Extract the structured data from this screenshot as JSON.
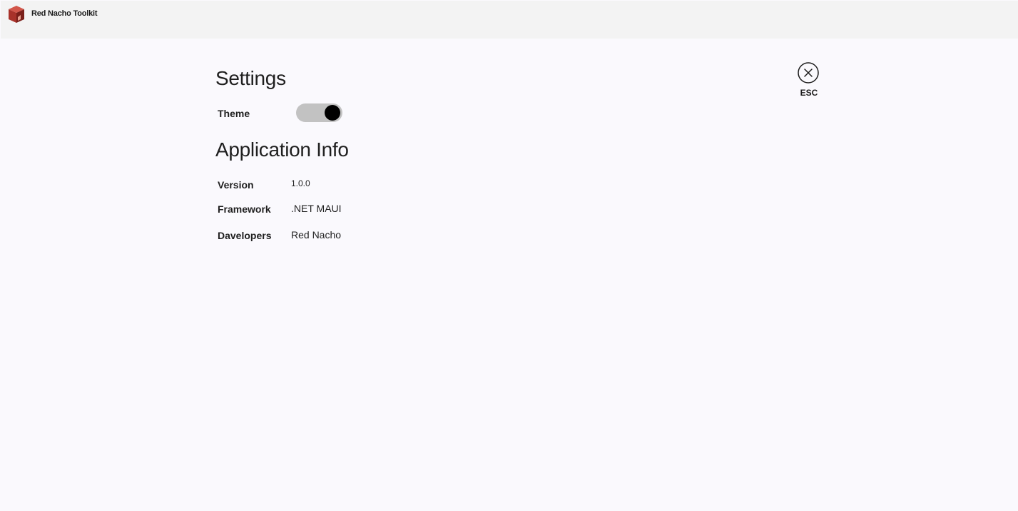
{
  "titlebar": {
    "app_name": "Red Nacho Toolkit",
    "logo_icon": "red-cube-logo-icon"
  },
  "settings": {
    "title": "Settings",
    "theme_label": "Theme",
    "theme_toggle_on": true
  },
  "app_info": {
    "title": "Application Info",
    "rows": [
      {
        "label": "Version",
        "value": "1.0.0"
      },
      {
        "label": "Framework",
        "value": ".NET MAUI"
      },
      {
        "label": "Davelopers",
        "value": "Red Nacho"
      }
    ]
  },
  "close": {
    "label": "ESC",
    "icon": "close-circle-icon"
  },
  "colors": {
    "background": "#faf9fd",
    "titlebar": "#f3f3f3",
    "toggle_track": "#c2c2c2",
    "toggle_knob": "#000000",
    "logo_red": "#c0392b"
  }
}
